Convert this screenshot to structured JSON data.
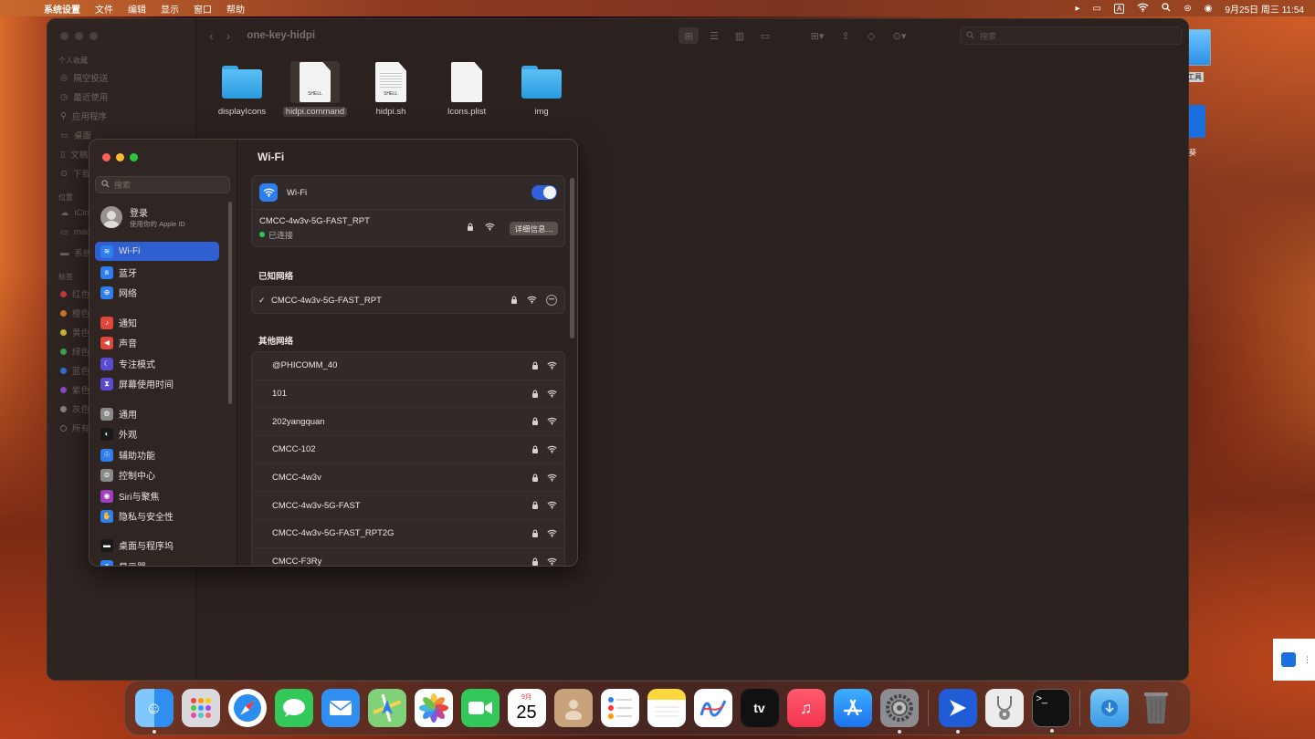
{
  "menubar": {
    "apple_icon": "",
    "items": [
      "系统设置",
      "文件",
      "编辑",
      "显示",
      "窗口",
      "帮助"
    ],
    "date_time": "9月25日 周三  11:54",
    "input_indicator": "A"
  },
  "finder": {
    "path_title": "one-key-hidpi",
    "search_placeholder": "搜索",
    "sidebar": {
      "favorites_header": "个人收藏",
      "favorites": [
        "隔空投送",
        "最近使用",
        "应用程序",
        "桌面",
        "文稿",
        "下载"
      ],
      "locations_header": "位置",
      "locations": [
        "iCloud",
        "mac",
        "系统"
      ],
      "tags_header": "标签",
      "tags": [
        {
          "label": "红色",
          "color": "#c23a3a"
        },
        {
          "label": "橙色",
          "color": "#c8762a"
        },
        {
          "label": "黄色",
          "color": "#c9b233"
        },
        {
          "label": "绿色",
          "color": "#3aa04a"
        },
        {
          "label": "蓝色",
          "color": "#3a6ad0"
        },
        {
          "label": "紫色",
          "color": "#8a4ac0"
        },
        {
          "label": "灰色",
          "color": "#808080"
        },
        {
          "label": "所有",
          "color": "transparent"
        }
      ]
    },
    "files": [
      {
        "name": "displayIcons",
        "type": "folder"
      },
      {
        "name": "hidpi.command",
        "type": "shell",
        "selected": true
      },
      {
        "name": "hidpi.sh",
        "type": "shell"
      },
      {
        "name": "Icons.plist",
        "type": "doc"
      },
      {
        "name": "img",
        "type": "folder"
      }
    ]
  },
  "desktop": {
    "label1": "工具",
    "label2": "葵"
  },
  "settings": {
    "search_placeholder": "搜索",
    "account": {
      "title": "登录",
      "subtitle": "使用你的 Apple ID"
    },
    "nav": [
      {
        "label": "Wi-Fi",
        "icon": "wifi-icon",
        "color": "#2f7ef0",
        "active": true
      },
      {
        "label": "蓝牙",
        "icon": "bluetooth-icon",
        "color": "#2f7ef0"
      },
      {
        "label": "网络",
        "icon": "globe-icon",
        "color": "#2f7ef0"
      },
      {
        "label": "通知",
        "icon": "bell-icon",
        "color": "#e0463c"
      },
      {
        "label": "声音",
        "icon": "speaker-icon",
        "color": "#e0463c"
      },
      {
        "label": "专注模式",
        "icon": "moon-icon",
        "color": "#5a4ad0"
      },
      {
        "label": "屏幕使用时间",
        "icon": "hourglass-icon",
        "color": "#5a4ad0"
      },
      {
        "label": "通用",
        "icon": "gear-icon",
        "color": "#8a8a8a"
      },
      {
        "label": "外观",
        "icon": "appearance-icon",
        "color": "#1a1a1a"
      },
      {
        "label": "辅助功能",
        "icon": "accessibility-icon",
        "color": "#2f7ef0"
      },
      {
        "label": "控制中心",
        "icon": "control-center-icon",
        "color": "#8a8a8a"
      },
      {
        "label": "Siri与聚焦",
        "icon": "siri-icon",
        "color": "#a040c0"
      },
      {
        "label": "隐私与安全性",
        "icon": "hand-icon",
        "color": "#2f7ef0"
      },
      {
        "label": "桌面与程序坞",
        "icon": "dock-icon",
        "color": "#1a1a1a"
      },
      {
        "label": "显示器",
        "icon": "display-icon",
        "color": "#2f7ef0"
      }
    ],
    "main": {
      "title": "Wi-Fi",
      "wifi_label": "Wi-Fi",
      "wifi_on": true,
      "connected_network": "CMCC-4w3v-5G-FAST_RPT",
      "connected_status": "已连接",
      "details_button": "详细信息…",
      "known_header": "已知网络",
      "known_networks": [
        "CMCC-4w3v-5G-FAST_RPT"
      ],
      "other_header": "其他网络",
      "other_networks": [
        "@PHICOMM_40",
        "101",
        "202yangquan",
        "CMCC-102",
        "CMCC-4w3v",
        "CMCC-4w3v-5G-FAST",
        "CMCC-4w3v-5G-FAST_RPT2G",
        "CMCC-F3Ry"
      ]
    }
  },
  "dock": {
    "calendar_month": "9月",
    "calendar_day": "25",
    "tv_label": "tv",
    "apps": [
      "finder",
      "launchpad",
      "safari",
      "messages",
      "mail",
      "maps",
      "photos",
      "facetime",
      "calendar",
      "contacts",
      "reminders",
      "notes",
      "freeform",
      "apple-tv",
      "music",
      "app-store",
      "system-settings",
      "remote-desktop",
      "disk-utility",
      "terminal",
      "downloads",
      "trash"
    ]
  }
}
